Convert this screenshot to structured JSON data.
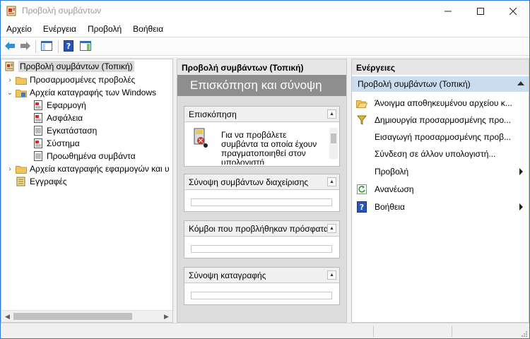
{
  "window": {
    "title": "Προβολή συμβάντων"
  },
  "menu": {
    "items": [
      "Αρχείο",
      "Ενέργεια",
      "Προβολή",
      "Βοήθεια"
    ]
  },
  "toolbar": {
    "buttons": [
      "back-icon",
      "forward-icon",
      "show-hide-tree-icon",
      "help-icon",
      "show-hide-action-pane-icon"
    ]
  },
  "tree": {
    "root": "Προβολή συμβάντων (Τοπική)",
    "items": [
      {
        "label": "Προσαρμοσμένες προβολές",
        "expanded": false
      },
      {
        "label": "Αρχεία καταγραφής των Windows",
        "expanded": true
      },
      {
        "label": "Εφαρμογή"
      },
      {
        "label": "Ασφάλεια"
      },
      {
        "label": "Εγκατάσταση"
      },
      {
        "label": "Σύστημα"
      },
      {
        "label": "Προωθημένα συμβάντα"
      },
      {
        "label": "Αρχεία καταγραφής εφαρμογών και υ",
        "expanded": false
      },
      {
        "label": "Εγγραφές"
      }
    ]
  },
  "middle": {
    "header": "Προβολή συμβάντων (Τοπική)",
    "banner": "Επισκόπηση και σύνοψη",
    "sections": [
      {
        "title": "Επισκόπηση",
        "text": "Για να προβάλετε συμβάντα τα οποία έχουν πραγματοποιηθεί στον υπολογιστή"
      },
      {
        "title": "Σύνοψη συμβάντων διαχείρισης"
      },
      {
        "title": "Κόμβοι που προβλήθηκαν πρόσφατα"
      },
      {
        "title": "Σύνοψη καταγραφής"
      }
    ]
  },
  "actions": {
    "header": "Ενέργειες",
    "sub_header": "Προβολή συμβάντων (Τοπική)",
    "items": [
      {
        "label": "Άνοιγμα αποθηκευμένου αρχείου κ...",
        "icon": "folder-open-icon",
        "submenu": false
      },
      {
        "label": "Δημιουργία προσαρμοσμένης προ...",
        "icon": "filter-icon",
        "submenu": false
      },
      {
        "label": "Εισαγωγή προσαρμοσμένης προβ...",
        "icon": "",
        "submenu": false
      },
      {
        "label": "Σύνδεση σε άλλον υπολογιστή...",
        "icon": "",
        "submenu": false
      },
      {
        "label": "Προβολή",
        "icon": "",
        "submenu": true
      },
      {
        "label": "Ανανέωση",
        "icon": "refresh-icon",
        "submenu": false
      },
      {
        "label": "Βοήθεια",
        "icon": "help-icon",
        "submenu": true
      }
    ]
  },
  "colors": {
    "window_border": "#2b79d8",
    "banner": "#8e8e8e",
    "action_sub_header": "#c9dcf0",
    "selection": "#d9d9d9"
  }
}
